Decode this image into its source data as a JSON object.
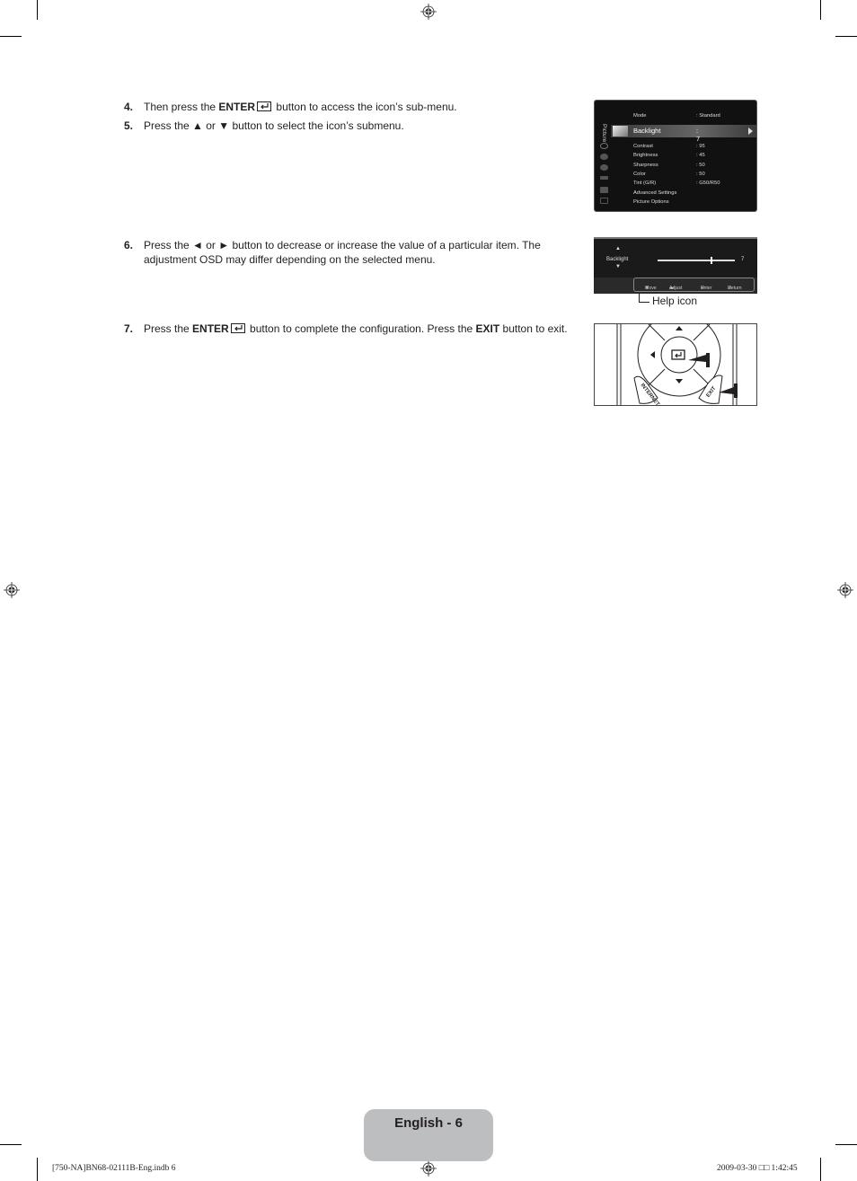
{
  "steps": [
    {
      "num": "4.",
      "parts": [
        "Then press the ",
        "ENTER",
        " button to access the icon’s sub-menu."
      ]
    },
    {
      "num": "5.",
      "text": "Press the ▲ or ▼ button to select the icon’s submenu."
    },
    {
      "num": "6.",
      "line1": "Press the ◄ or ► button to decrease or increase the value of a particular item. The",
      "line2": "adjustment OSD may differ depending on the selected menu."
    },
    {
      "num": "7.",
      "parts": [
        "Press the ",
        "ENTER",
        " button to complete the configuration. Press the ",
        "EXIT",
        " button to exit."
      ]
    }
  ],
  "osd_menu": {
    "category": "Picture",
    "highlighted": {
      "label": "Backlight",
      "value": ": 7"
    },
    "items": [
      {
        "label": "Mode",
        "value": ": Standard"
      },
      {
        "label": "Contrast",
        "value": ": 95"
      },
      {
        "label": "Brightness",
        "value": ": 45"
      },
      {
        "label": "Sharpness",
        "value": ": 50"
      },
      {
        "label": "Color",
        "value": ": 50"
      },
      {
        "label": "Tint (G/R)",
        "value": ": G50/R50"
      },
      {
        "label": "Advanced Settings",
        "value": ""
      },
      {
        "label": "Picture Options",
        "value": ""
      }
    ]
  },
  "osd_adjust": {
    "label": "Backlight",
    "value": "7",
    "slider_fraction": 0.7,
    "up_glyph": "▲",
    "down_glyph": "▼",
    "help": [
      {
        "icon": "move-icon",
        "glyph": "⬍",
        "label": "Move"
      },
      {
        "icon": "adjust-icon",
        "glyph": "◂▸",
        "label": "Adjust"
      },
      {
        "icon": "enter-icon",
        "glyph": "⏎",
        "label": "Enter"
      },
      {
        "icon": "return-icon",
        "glyph": "↺",
        "label": "Return"
      }
    ]
  },
  "callout": {
    "text": "Help icon"
  },
  "remote": {
    "internet_label": "INTERNET",
    "exit_label": "EXIT"
  },
  "footer": {
    "page_label": "English - 6",
    "file_slug": "[750-NA]BN68-02111B-Eng.indb   6",
    "timestamp": "2009-03-30   □□ 1:42:45"
  }
}
